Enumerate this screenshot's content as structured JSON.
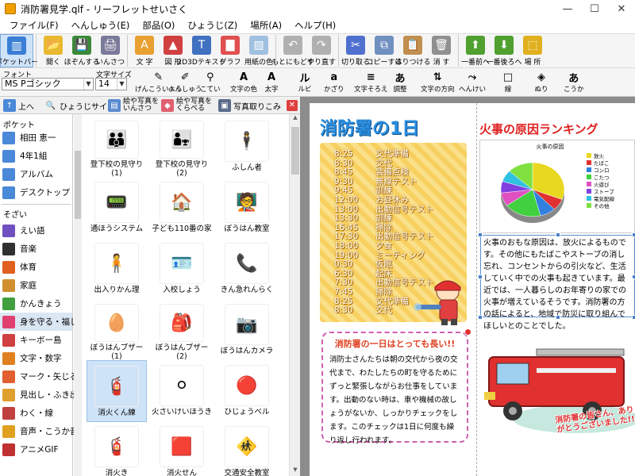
{
  "window": {
    "title": "消防署見学.qlf - リーフレットせいさく",
    "minimize": "—",
    "maximize": "☐",
    "close": "✕"
  },
  "menu": [
    "ファイル(F)",
    "へんしゅう(E)",
    "部品(O)",
    "ひょうじ(Z)",
    "場所(A)",
    "ヘルプ(H)"
  ],
  "toolbar1": [
    {
      "label": "ポケットバー",
      "color": "#3a7fd5"
    },
    {
      "label": "開く",
      "color": "#e8b830"
    },
    {
      "label": "ほぞんする",
      "color": "#3a8a3a"
    },
    {
      "label": "いんさつ",
      "color": "#7a7a9a"
    },
    {
      "label": "文 字",
      "color": "#e8a030"
    },
    {
      "label": "図 形",
      "color": "#d04040"
    },
    {
      "label": "2D3Dテキスト",
      "color": "#4070c0"
    },
    {
      "label": "グラフ",
      "color": "#e05050"
    },
    {
      "label": "用紙の色",
      "color": "#a0c0e0"
    },
    {
      "label": "もとにもどす",
      "color": "#b0b0b0"
    },
    {
      "label": "やり直す",
      "color": "#b0b0b0"
    },
    {
      "label": "切り取る",
      "color": "#5070d0"
    },
    {
      "label": "コピーする",
      "color": "#7090c0"
    },
    {
      "label": "はりつける",
      "color": "#c09050"
    },
    {
      "label": "消 す",
      "color": "#909090"
    },
    {
      "label": "一番前へ",
      "color": "#50a030"
    },
    {
      "label": "一番後ろへ",
      "color": "#50a030"
    },
    {
      "label": "場 所",
      "color": "#e0b020"
    }
  ],
  "format": {
    "font_label": "フォント",
    "font_value": "MS Pゴシック",
    "size_label": "文字サイズ",
    "size_value": "14",
    "tools": [
      "げんこういよう",
      "へんしゅう",
      "こてい",
      "文字の色",
      "太字",
      "ルビ",
      "かざり",
      "文字そろえ",
      "調整",
      "文字の方向",
      "へんけい",
      "線",
      "ぬり",
      "こうか"
    ]
  },
  "nav": {
    "up": "上へ",
    "view_size": "ひょうじサイズ・",
    "print": "絵や写真を\nいんさつ",
    "compare": "絵や写真を\nくらべる",
    "import": "写真取りこみ"
  },
  "left": {
    "pocket_head": "ポケット",
    "pocket": [
      {
        "label": "相田 恵一",
        "color": "#4a88d8"
      },
      {
        "label": "4年1組",
        "color": "#4a88d8"
      },
      {
        "label": "アルバム",
        "color": "#4a88d8"
      },
      {
        "label": "デスクトップ",
        "color": "#4a88d8"
      }
    ],
    "parts_head": "そざい",
    "parts": [
      {
        "label": "えい語",
        "color": "#7050c0"
      },
      {
        "label": "音楽",
        "color": "#303030"
      },
      {
        "label": "体育",
        "color": "#e06020"
      },
      {
        "label": "家庭",
        "color": "#d09030"
      },
      {
        "label": "かんきょう",
        "color": "#40a040"
      },
      {
        "label": "身を守る・福し",
        "color": "#e04070"
      },
      {
        "label": "キーボー島",
        "color": "#d04040"
      },
      {
        "label": "文字・数字",
        "color": "#e08020"
      },
      {
        "label": "マーク・矢じるし",
        "color": "#e06030"
      },
      {
        "label": "見出し・ふき出し",
        "color": "#e0a030"
      },
      {
        "label": "わく・線",
        "color": "#c04040"
      },
      {
        "label": "音声・こうか音",
        "color": "#e0a020"
      },
      {
        "label": "アニメGIF",
        "color": "#c03030"
      }
    ],
    "selected_index": 5
  },
  "grid": [
    {
      "label": "登下校の見守り(1)",
      "icon": "👪"
    },
    {
      "label": "登下校の見守り(2)",
      "icon": "👨‍👧"
    },
    {
      "label": "ふしん者",
      "icon": "🕴"
    },
    {
      "label": "通ほうシステム",
      "icon": "📟"
    },
    {
      "label": "子ども110番の家",
      "icon": "🏠"
    },
    {
      "label": "ぼうはん教室",
      "icon": "🧑‍🏫"
    },
    {
      "label": "出入りかん理",
      "icon": "🧍"
    },
    {
      "label": "入校しょう",
      "icon": "🪪"
    },
    {
      "label": "きん急れんらく",
      "icon": "📞"
    },
    {
      "label": "ぼうはんブザー(1)",
      "icon": "🥚"
    },
    {
      "label": "ぼうはんブザー(2)",
      "icon": "🎒"
    },
    {
      "label": "ぼうはんカメラ",
      "icon": "📷"
    },
    {
      "label": "消火くん練",
      "icon": "🧯"
    },
    {
      "label": "火さいけいほうき",
      "icon": "⚪"
    },
    {
      "label": "ひじょうベル",
      "icon": "🔴"
    },
    {
      "label": "消火き",
      "icon": "🧯"
    },
    {
      "label": "消火せん",
      "icon": "🟥"
    },
    {
      "label": "交通安全教室",
      "icon": "🚸"
    }
  ],
  "grid_selected_index": 12,
  "doc": {
    "title": "消防署の1日",
    "schedule": [
      {
        "time": "8:25",
        "event": "交代準備"
      },
      {
        "time": "8:30",
        "event": "交代"
      },
      {
        "time": "8:45",
        "event": "装備点検"
      },
      {
        "time": "9:30",
        "event": "無線テスト"
      },
      {
        "time": "9:45",
        "event": "訓練"
      },
      {
        "time": "12:00",
        "event": "お昼休み"
      },
      {
        "time": "13:00",
        "event": "出動信号テスト"
      },
      {
        "time": "13:30",
        "event": "訓練"
      },
      {
        "time": "16:45",
        "event": "掃除"
      },
      {
        "time": "17:30",
        "event": "出動信号テスト"
      },
      {
        "time": "18:00",
        "event": "夕食"
      },
      {
        "time": "19:00",
        "event": "ミーティング"
      },
      {
        "time": "0:30",
        "event": "仮眠"
      },
      {
        "time": "6:30",
        "event": "起床"
      },
      {
        "time": "7:30",
        "event": "出動信号テスト"
      },
      {
        "time": "7:45",
        "event": "掃除"
      },
      {
        "time": "8:25",
        "event": "交代準備"
      },
      {
        "time": "8:30",
        "event": "交代"
      }
    ],
    "ranking_title": "火事の原因ランキング",
    "body": "火事のおもな原因は、放火によるものです。その他にもたばこやストーブの消し忘れ、コンセントからの引火など、生活していく中での火事も起きています。最近では、一人暮らしのお年寄りの家での火事が増えているそうです。消防署の方の話によると、地域で防災に取り組んでほしいとのことでした。",
    "duty_title": "消防署の一日はとっても長い!!",
    "duty_body": "消防士さんたちは朝の交代から夜の交代まで、わたしたちの町を守るためにずっと緊張しながらお仕事をしています。出動のない時は、車や機械の故しょうがないか、しっかりチェックをします。このチェックは1日に何度も繰り返し行われます。",
    "truck_label": "消防署の皆さん、ありがとうございました!!"
  },
  "chart_data": {
    "type": "pie",
    "title": "火事の原因",
    "categories": [
      "放火",
      "たばこ",
      "コンロ",
      "こたつ",
      "火遊び",
      "ストーブ",
      "電気配線",
      "その他"
    ],
    "values": [
      31,
      7,
      8,
      19,
      8,
      7,
      7,
      13
    ],
    "colors": [
      "#e8d820",
      "#e03030",
      "#3080e0",
      "#40d040",
      "#e050c0",
      "#8040e0",
      "#30c0e0",
      "#80e040"
    ],
    "legend": "right"
  }
}
